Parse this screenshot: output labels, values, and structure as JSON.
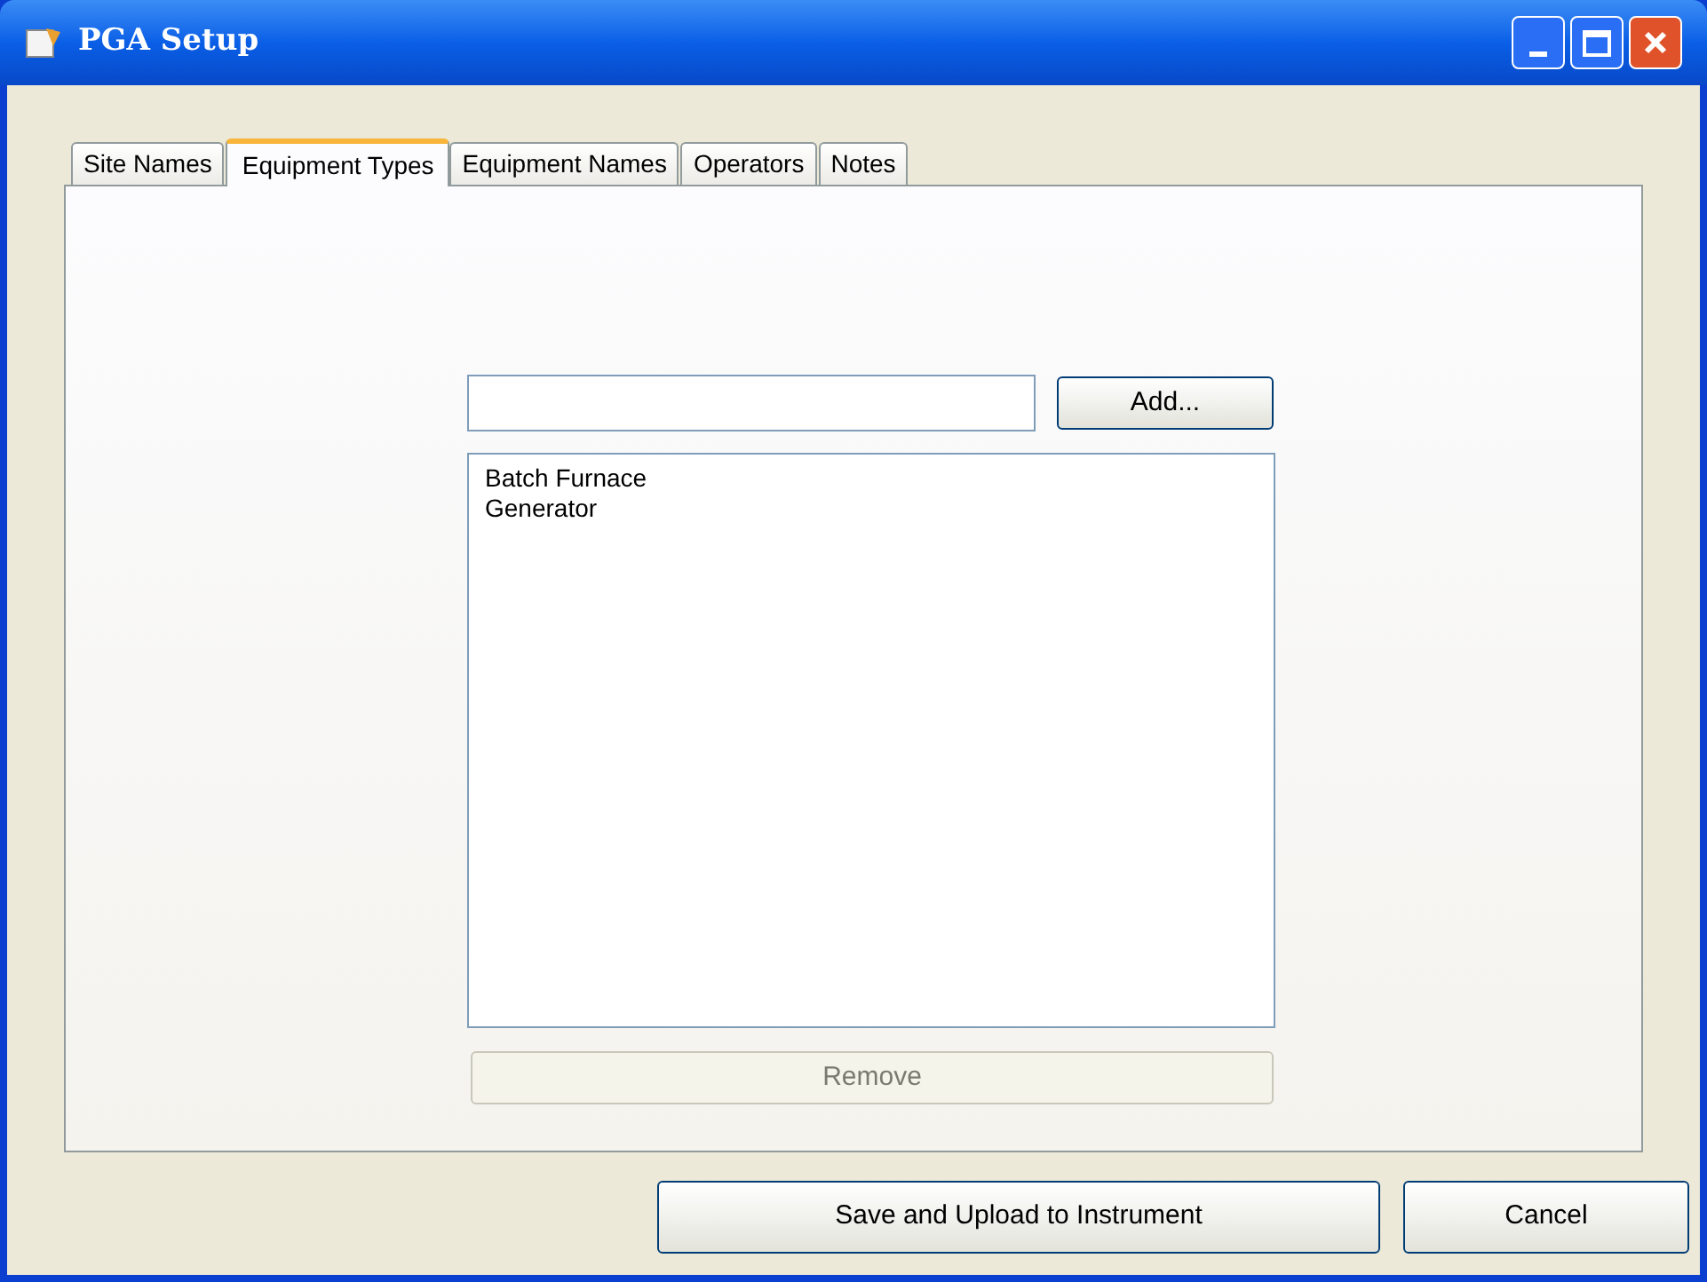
{
  "window": {
    "title": "PGA Setup"
  },
  "tabs": [
    {
      "label": "Site Names",
      "selected": false
    },
    {
      "label": "Equipment Types",
      "selected": true
    },
    {
      "label": "Equipment Names",
      "selected": false
    },
    {
      "label": "Operators",
      "selected": false
    },
    {
      "label": "Notes",
      "selected": false
    }
  ],
  "add_button": "Add...",
  "list_items": [
    "Batch Furnace",
    "Generator"
  ],
  "remove_button": {
    "label": "Remove",
    "disabled": true
  },
  "buttons": [
    "Save and Upload to Instrument",
    "Cancel"
  ]
}
